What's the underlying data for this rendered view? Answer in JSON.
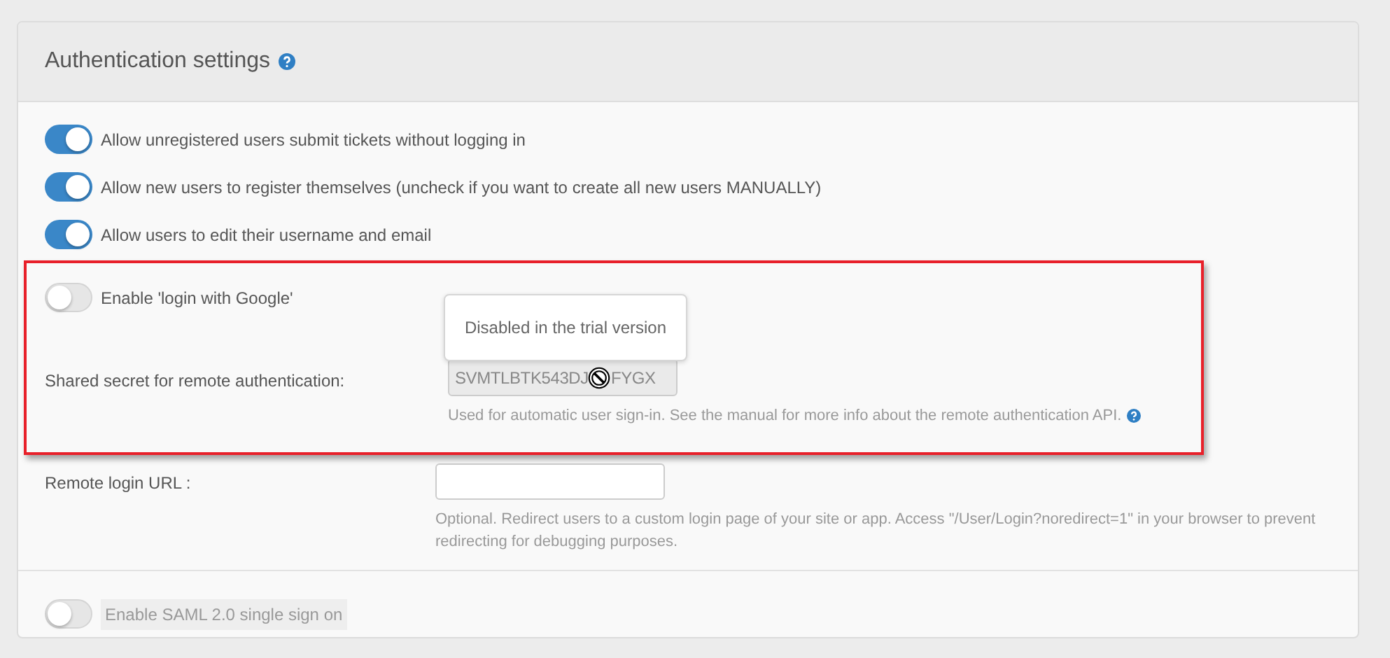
{
  "panel": {
    "title": "Authentication settings"
  },
  "toggles": [
    {
      "label": "Allow unregistered users submit tickets without logging in",
      "on": true
    },
    {
      "label": "Allow new users to register themselves (uncheck if you want to create all new users MANUALLY)",
      "on": true
    },
    {
      "label": "Allow users to edit their username and email",
      "on": true
    }
  ],
  "highlight": {
    "google_toggle": {
      "label": "Enable 'login with Google'",
      "on": false
    },
    "tooltip": "Disabled in the trial version",
    "secret": {
      "label": "Shared secret for remote authentication:",
      "value_start": "SVMTLBTK543DJ",
      "value_end": "FYGX",
      "disabled": true,
      "help": "Used for automatic user sign-in. See the manual for more info about the remote authentication API."
    }
  },
  "remote_login": {
    "label": "Remote login URL :",
    "help": "Optional. Redirect users to a custom login page of your site or app. Access \"/User/Login?noredirect=1\" in your browser to prevent redirecting for debugging purposes."
  },
  "saml_toggle": {
    "label": "Enable SAML 2.0 single sign on",
    "on": false,
    "disabled": true
  }
}
